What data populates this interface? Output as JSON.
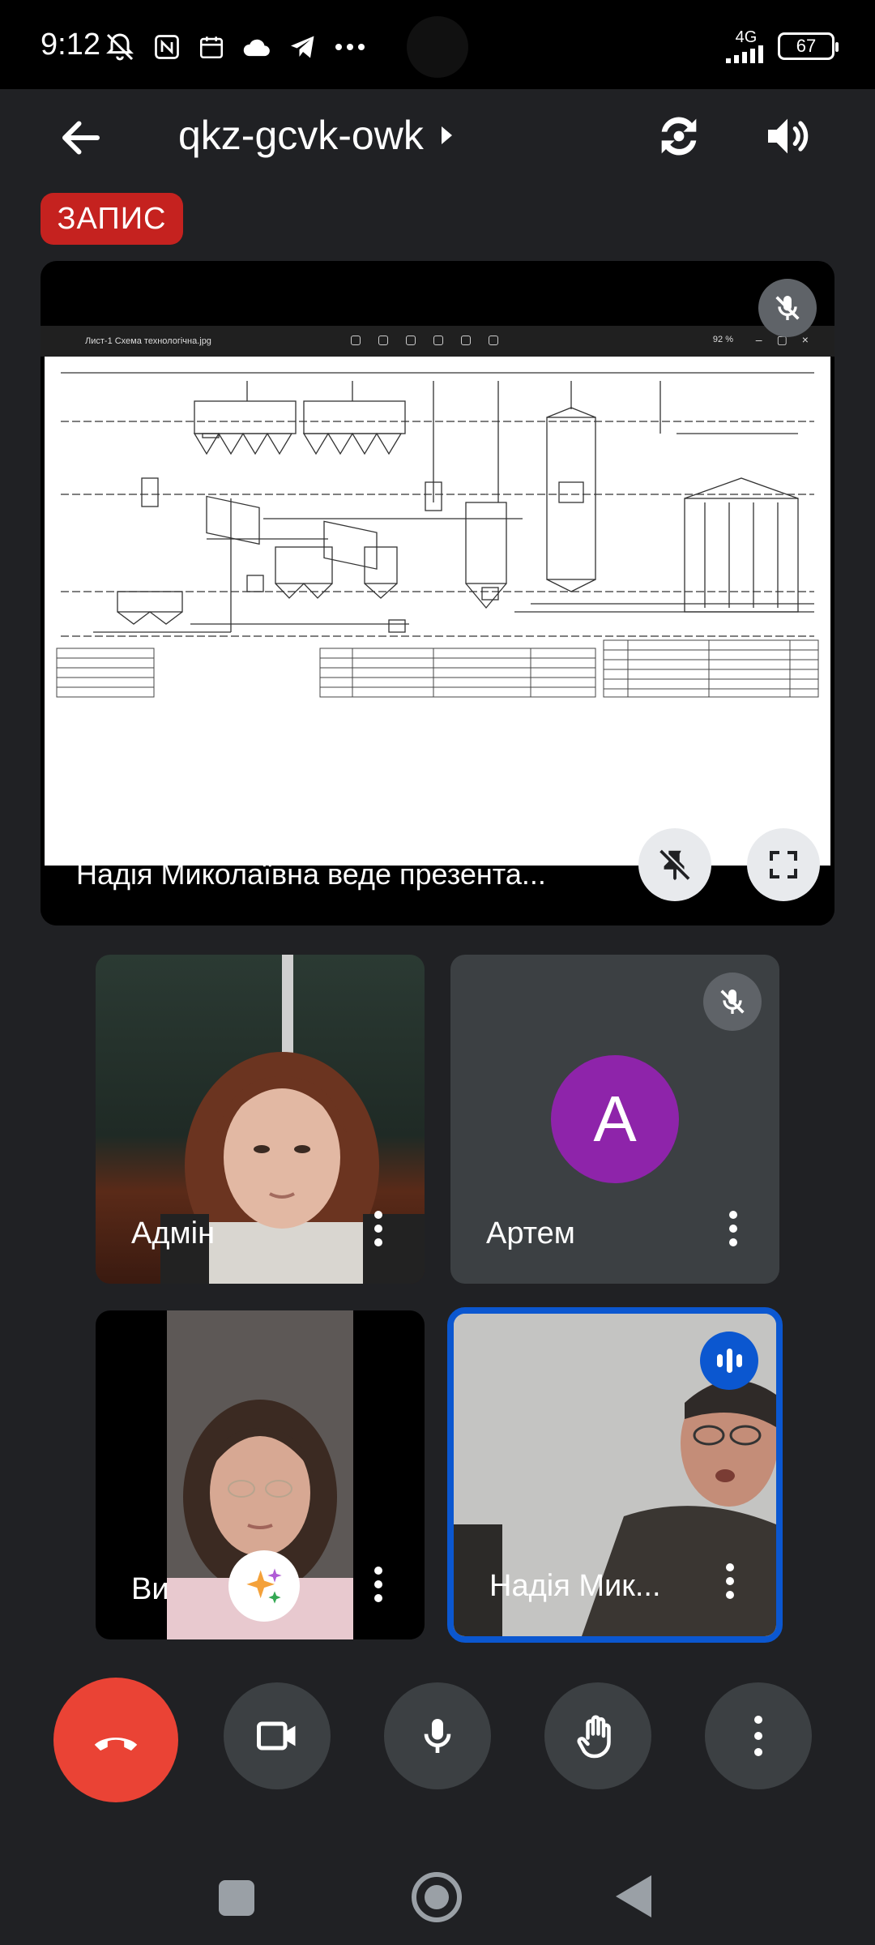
{
  "status_bar": {
    "time": "9:12",
    "network": "4G",
    "battery": "67"
  },
  "header": {
    "meeting_code": "qkz-gcvk-owk"
  },
  "recording_badge": "ЗАПИС",
  "presentation": {
    "label": "Надія Миколаївна веде презента...",
    "document": {
      "file_title": "Лист-1 Схема технологічна.jpg",
      "zoom": "92 %"
    }
  },
  "participants": [
    {
      "name": "Адмін",
      "muted": false
    },
    {
      "name": "Артем",
      "avatar_letter": "А",
      "avatar_color": "#8e24aa",
      "muted": true
    },
    {
      "name": "Ви",
      "muted": false
    },
    {
      "name": "Надія Мик...",
      "speaking": true,
      "highlight_color": "#0b57d0"
    }
  ],
  "controls": {
    "end_call_color": "#ea4335",
    "icons": [
      "phone-hangup-icon",
      "video-camera-icon",
      "microphone-icon",
      "raise-hand-icon",
      "more-vert-icon"
    ]
  },
  "colors": {
    "background": "#202124",
    "record_red": "#c5221f",
    "tile_bg": "#3c4043"
  }
}
